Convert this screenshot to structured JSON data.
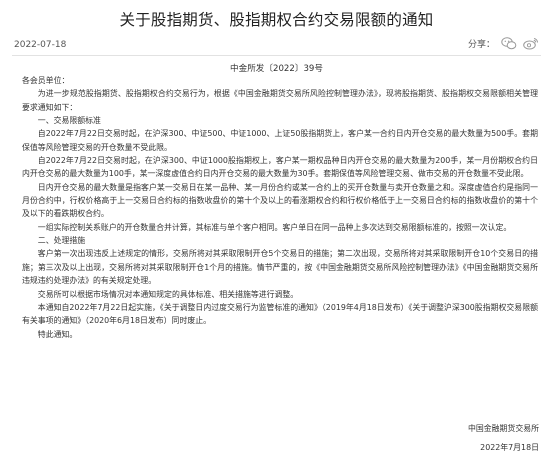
{
  "header": {
    "title": "关于股指期货、股指期权合约交易限额的通知",
    "date": "2022-07-18",
    "share_label": "分享："
  },
  "share_icons": [
    "wechat-icon",
    "weibo-icon"
  ],
  "document": {
    "number": "中金所发〔2022〕39号",
    "salutation": "各会员单位：",
    "intro": "为进一步规范股指期货、股指期权合约交易行为，根据《中国金融期货交易所风险控制管理办法》，现将股指期货、股指期权交易限额相关管理要求通知如下：",
    "section1_title": "一、交易限额标准",
    "p1": "自2022年7月22日交易时起，在沪深300、中证500、中证1000、上证50股指期货上，客户某一合约日内开仓交易的最大数量为500手。套期保值等风险管理交易的开仓数量不受此限。",
    "p2": "自2022年7月22日交易时起，在沪深300、中证1000股指期权上，客户某一期权品种日内开仓交易的最大数量为200手，某一月份期权合约日内开仓交易的最大数量为100手，某一深度虚值合约日内开仓交易的最大数量为30手。套期保值等风险管理交易、做市交易的开仓数量不受此限。",
    "p3": "日内开仓交易的最大数量是指客户某一交易日在某一品种、某一月份合约或某一合约上的买开仓数量与卖开仓数量之和。深度虚值合约是指同一月份合约中，行权价格高于上一交易日合约标的指数收盘价的第十个及以上的看涨期权合约和行权价格低于上一交易日合约标的指数收盘价的第十个及以下的看跌期权合约。",
    "p4": "一组实际控制关系账户的开仓数量合并计算，其标准与单个客户相同。客户单日在同一品种上多次达到交易限额标准的，按照一次认定。",
    "section2_title": "二、处理措施",
    "p5": "客户第一次出现违反上述规定的情形，交易所将对其采取限制开仓5个交易日的措施；第二次出现，交易所将对其采取限制开仓10个交易日的措施；第三次及以上出现，交易所将对其采取限制开仓1个月的措施。情节严重的，按《中国金融期货交易所风险控制管理办法》《中国金融期货交易所违规违约处理办法》的有关规定处理。",
    "p6": "交易所可以根据市场情况对本通知规定的具体标准、相关措施等进行调整。",
    "p7": "本通知自2022年7月22日起实施，《关于调整日内过度交易行为监管标准的通知》（2019年4月18日发布）《关于调整沪深300股指期权交易限额有关事项的通知》（2020年6月18日发布）同时废止。",
    "closing": "特此通知。",
    "signature": "中国金融期货交易所",
    "signature_date": "2022年7月18日"
  }
}
